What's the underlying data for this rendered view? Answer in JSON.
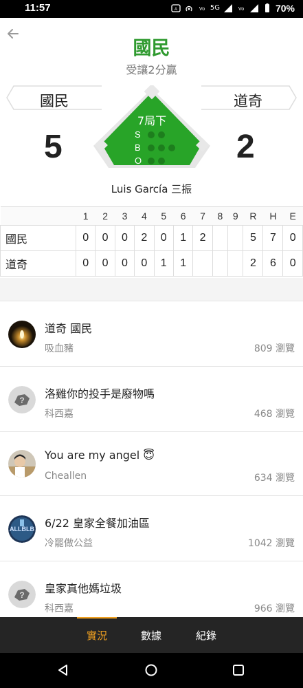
{
  "status": {
    "time": "11:57",
    "net_label": "5G",
    "battery": "70%"
  },
  "game": {
    "favorite_team": "國民",
    "spread": "受讓2分贏",
    "away_team": "國民",
    "home_team": "道奇",
    "away_score": "5",
    "home_score": "2",
    "inning": "7局下",
    "sbo_labels": [
      "S",
      "B",
      "O"
    ],
    "last_play": "Luis García 三振"
  },
  "boxscore": {
    "headers": [
      "1",
      "2",
      "3",
      "4",
      "5",
      "6",
      "7",
      "8",
      "9",
      "R",
      "H",
      "E"
    ],
    "rows": [
      {
        "team": "國民",
        "cells": [
          "0",
          "0",
          "0",
          "2",
          "0",
          "1",
          "2",
          "",
          "",
          "5",
          "7",
          "0"
        ]
      },
      {
        "team": "道奇",
        "cells": [
          "0",
          "0",
          "0",
          "0",
          "1",
          "1",
          "",
          "",
          "",
          "2",
          "6",
          "0"
        ]
      }
    ]
  },
  "posts": [
    {
      "title": "道奇 國民",
      "author": "吸血豬",
      "views": "809 瀏覽",
      "avatar": "candle-avatar"
    },
    {
      "title": "洛雞你的投手是廢物嗎",
      "author": "科西嘉",
      "views": "468 瀏覽",
      "avatar": "default-avatar"
    },
    {
      "title": "You are my angel 😇",
      "author": "Cheallen",
      "views": "634 瀏覽",
      "avatar": "photo-avatar"
    },
    {
      "title": "6/22 皇家全餐加油區",
      "author": "冷罷做公益",
      "views": "1042 瀏覽",
      "avatar": "team-avatar"
    },
    {
      "title": "皇家真他媽垃圾",
      "author": "科西嘉",
      "views": "966 瀏覽",
      "avatar": "default-avatar"
    }
  ],
  "tabs": [
    "實況",
    "數據",
    "紀錄"
  ],
  "colors": {
    "accent_green": "#2f9a2f",
    "diamond_green": "#28a428",
    "tab_active": "#f0a020",
    "tabbar_bg": "#252525"
  },
  "icons": [
    "back-arrow-icon",
    "nav-back-icon",
    "nav-home-icon",
    "nav-recents-icon"
  ]
}
